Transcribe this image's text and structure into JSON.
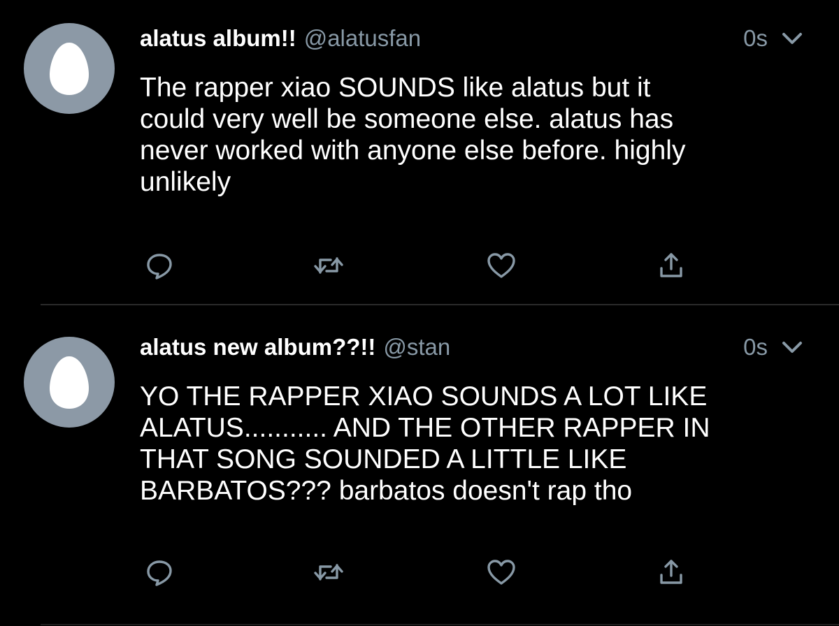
{
  "colors": {
    "background": "#000000",
    "text_primary": "#ffffff",
    "text_secondary": "#8899a6",
    "avatar_bg": "#8c99a6",
    "divider": "#2a2a2a"
  },
  "tweets": [
    {
      "display_name": "alatus album!!",
      "handle": "@alatusfan",
      "time": "0s",
      "avatar_icon": "egg-icon",
      "body_lines": [
        "The rapper xiao SOUNDS like alatus but it",
        "could very well be someone else. alatus has",
        "never worked with anyone else before. highly",
        "unlikely"
      ],
      "actions": [
        "reply-icon",
        "retweet-icon",
        "like-icon",
        "share-icon"
      ]
    },
    {
      "display_name": "alatus new album??!!",
      "handle": "@stan",
      "time": "0s",
      "avatar_icon": "egg-icon",
      "body_lines": [
        "YO THE RAPPER XIAO SOUNDS A LOT LIKE",
        "ALATUS........... AND THE OTHER RAPPER IN",
        "THAT SONG SOUNDED A LITTLE LIKE",
        "BARBATOS??? barbatos doesn't rap tho"
      ],
      "actions": [
        "reply-icon",
        "retweet-icon",
        "like-icon",
        "share-icon"
      ]
    }
  ]
}
